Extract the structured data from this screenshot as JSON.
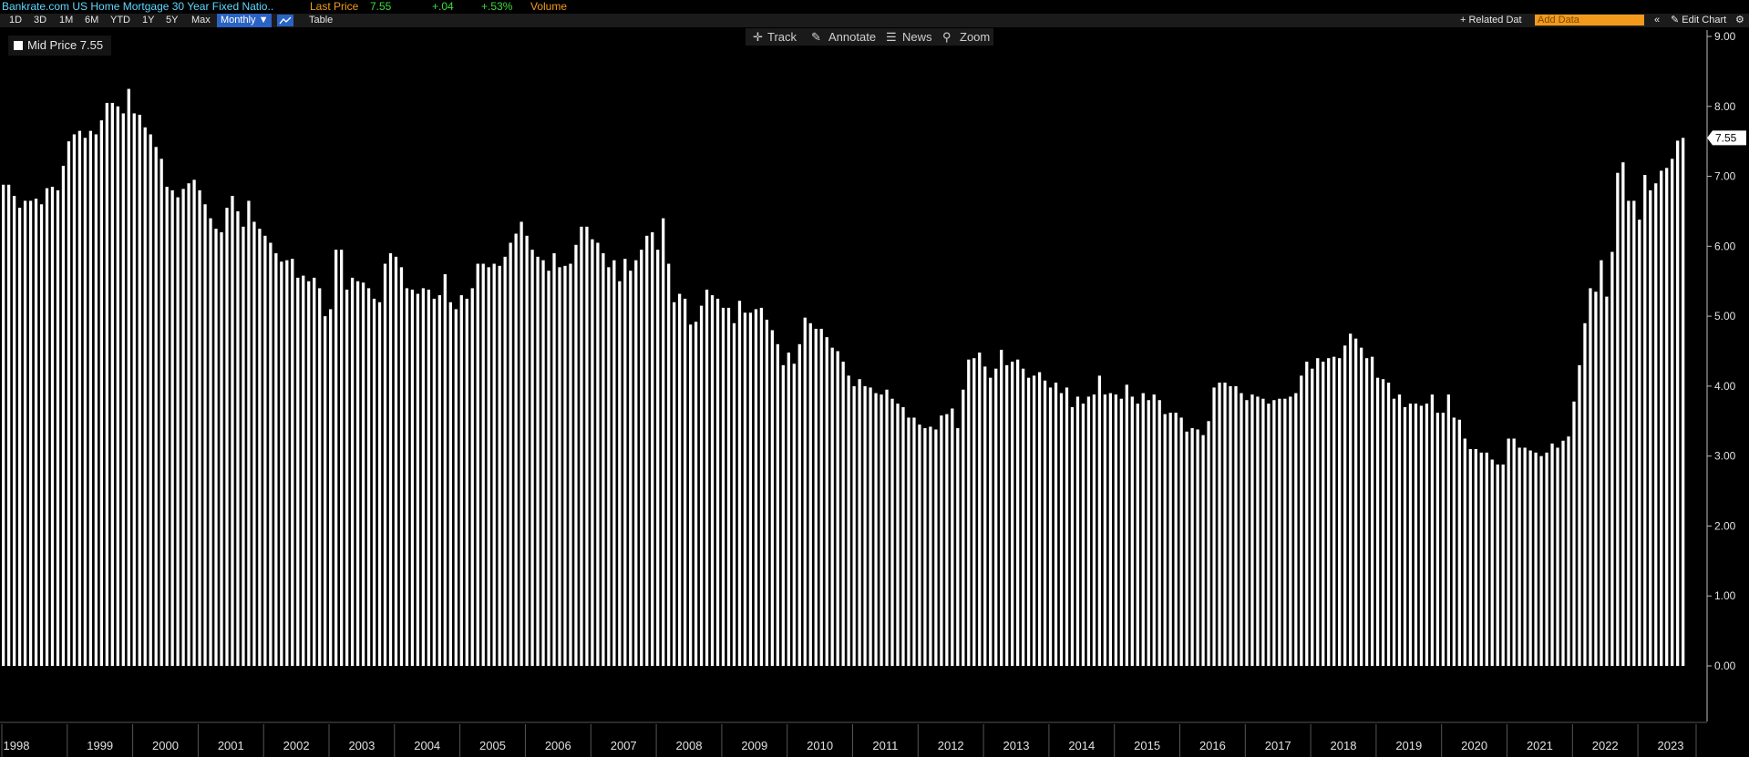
{
  "header": {
    "security": "Bankrate.com US Home Mortgage 30 Year Fixed Natio..",
    "last_price_label": "Last Price",
    "last_price": "7.55",
    "change": "+.04",
    "change_pct": "+.53%",
    "volume_label": "Volume"
  },
  "toolbar": {
    "ranges": [
      "1D",
      "3D",
      "1M",
      "6M",
      "YTD",
      "1Y",
      "5Y",
      "Max"
    ],
    "frequency": "Monthly ▼",
    "table_label": "Table",
    "related_label": "+ Related Dat",
    "add_data_placeholder": "Add Data",
    "collapse": "«",
    "edit_chart": "✎ Edit Chart",
    "settings_icon": "gear-icon"
  },
  "chart_tools": {
    "track": "Track",
    "annotate": "Annotate",
    "news": "News",
    "zoom": "Zoom"
  },
  "legend": {
    "label": "Mid Price 7.55"
  },
  "colors": {
    "bar": "#ffffff",
    "background": "#000000",
    "ticker": "#5fd7ff",
    "orange": "#f39a1d",
    "green": "#3ddc3d"
  },
  "chart_data": {
    "type": "bar",
    "start": "1998-01",
    "frequency": "monthly",
    "ylim": [
      -0.8,
      9.0
    ],
    "yticks": [
      "0.00",
      "1.00",
      "2.00",
      "3.00",
      "4.00",
      "5.00",
      "6.00",
      "7.00",
      "8.00",
      "9.00"
    ],
    "last_value_label": "7.55",
    "year_labels": [
      "1998",
      "1999",
      "2000",
      "2001",
      "2002",
      "2003",
      "2004",
      "2005",
      "2006",
      "2007",
      "2008",
      "2009",
      "2010",
      "2011",
      "2012",
      "2013",
      "2014",
      "2015",
      "2016",
      "2017",
      "2018",
      "2019",
      "2020",
      "2021",
      "2022",
      "2023"
    ],
    "values": [
      6.88,
      6.88,
      6.72,
      6.55,
      6.65,
      6.65,
      6.68,
      6.6,
      6.83,
      6.85,
      6.8,
      7.15,
      7.5,
      7.6,
      7.65,
      7.55,
      7.65,
      7.6,
      7.8,
      8.05,
      8.05,
      8.0,
      7.9,
      8.25,
      7.9,
      7.88,
      7.7,
      7.6,
      7.42,
      7.25,
      6.85,
      6.8,
      6.7,
      6.82,
      6.9,
      6.95,
      6.8,
      6.6,
      6.4,
      6.25,
      6.2,
      6.55,
      6.72,
      6.5,
      6.28,
      6.65,
      6.35,
      6.25,
      6.15,
      6.05,
      5.9,
      5.78,
      5.8,
      5.82,
      5.55,
      5.58,
      5.5,
      5.55,
      5.4,
      5.0,
      5.1,
      5.95,
      5.95,
      5.38,
      5.55,
      5.5,
      5.48,
      5.4,
      5.25,
      5.2,
      5.75,
      5.9,
      5.85,
      5.7,
      5.4,
      5.38,
      5.32,
      5.4,
      5.38,
      5.25,
      5.3,
      5.6,
      5.2,
      5.1,
      5.3,
      5.25,
      5.4,
      5.75,
      5.75,
      5.7,
      5.75,
      5.72,
      5.85,
      6.05,
      6.18,
      6.35,
      6.15,
      5.95,
      5.85,
      5.8,
      5.65,
      5.9,
      5.7,
      5.72,
      5.75,
      6.02,
      6.28,
      6.28,
      6.1,
      6.05,
      5.9,
      5.7,
      5.8,
      5.5,
      5.82,
      5.65,
      5.8,
      5.95,
      6.15,
      6.2,
      5.95,
      6.4,
      5.75,
      5.2,
      5.32,
      5.25,
      4.88,
      4.92,
      5.15,
      5.38,
      5.3,
      5.25,
      5.12,
      5.12,
      4.9,
      5.22,
      5.05,
      5.05,
      5.1,
      5.12,
      4.95,
      4.8,
      4.6,
      4.3,
      4.48,
      4.32,
      4.6,
      4.98,
      4.9,
      4.82,
      4.82,
      4.7,
      4.55,
      4.5,
      4.35,
      4.15,
      4.0,
      4.1,
      4.0,
      3.98,
      3.9,
      3.88,
      3.95,
      3.82,
      3.75,
      3.7,
      3.55,
      3.55,
      3.45,
      3.4,
      3.42,
      3.38,
      3.58,
      3.6,
      3.68,
      3.4,
      3.95,
      4.38,
      4.4,
      4.48,
      4.28,
      4.12,
      4.25,
      4.52,
      4.3,
      4.35,
      4.38,
      4.25,
      4.12,
      4.15,
      4.2,
      4.08,
      3.98,
      4.05,
      3.9,
      3.98,
      3.7,
      3.85,
      3.75,
      3.85,
      3.88,
      4.15,
      3.88,
      3.9,
      3.88,
      3.82,
      4.02,
      3.85,
      3.75,
      3.9,
      3.8,
      3.88,
      3.8,
      3.6,
      3.62,
      3.62,
      3.55,
      3.35,
      3.4,
      3.38,
      3.3,
      3.5,
      3.98,
      4.05,
      4.05,
      4.0,
      4.0,
      3.9,
      3.8,
      3.88,
      3.85,
      3.82,
      3.75,
      3.8,
      3.82,
      3.82,
      3.85,
      3.9,
      4.15,
      4.35,
      4.25,
      4.4,
      4.35,
      4.4,
      4.42,
      4.4,
      4.58,
      4.75,
      4.68,
      4.55,
      4.4,
      4.42,
      4.12,
      4.1,
      4.05,
      3.82,
      3.88,
      3.7,
      3.75,
      3.75,
      3.72,
      3.75,
      3.88,
      3.62,
      3.62,
      3.88,
      3.55,
      3.52,
      3.25,
      3.1,
      3.1,
      3.05,
      3.05,
      2.95,
      2.88,
      2.88,
      3.25,
      3.25,
      3.12,
      3.12,
      3.08,
      3.05,
      3.0,
      3.05,
      3.18,
      3.12,
      3.22,
      3.28,
      3.78,
      4.3,
      4.9,
      5.4,
      5.35,
      5.8,
      5.28,
      5.92,
      7.05,
      7.2,
      6.65,
      6.65,
      6.38,
      7.02,
      6.8,
      6.9,
      7.08,
      7.12,
      7.25,
      7.51,
      7.55
    ]
  }
}
